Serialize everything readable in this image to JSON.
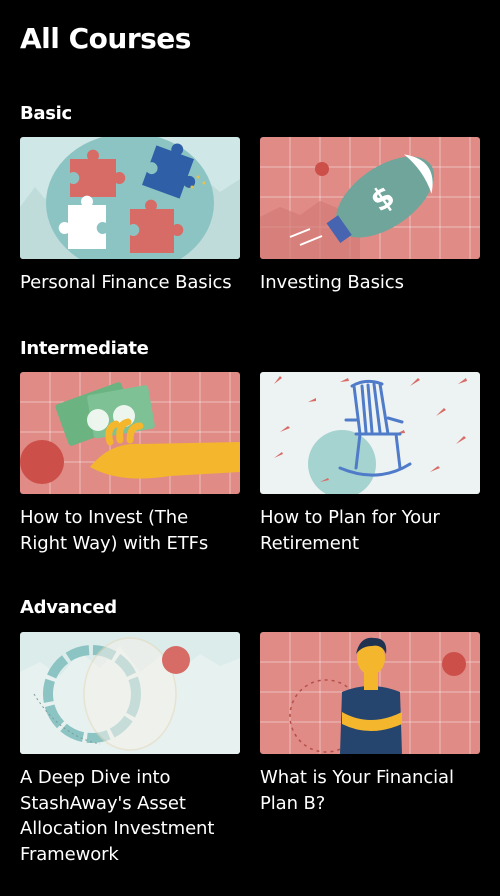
{
  "page": {
    "title": "All Courses"
  },
  "sections": [
    {
      "heading": "Basic",
      "courses": [
        {
          "title": "Personal Finance Basics",
          "thumb_bg": "#cfe7e6"
        },
        {
          "title": "Investing Basics",
          "thumb_bg": "#e08b86"
        }
      ]
    },
    {
      "heading": "Intermediate",
      "courses": [
        {
          "title": "How to Invest (The Right Way) with ETFs",
          "thumb_bg": "#e08b86"
        },
        {
          "title": "How to Plan for Your Retirement",
          "thumb_bg": "#edf3f3"
        }
      ]
    },
    {
      "heading": "Advanced",
      "courses": [
        {
          "title": "A Deep Dive into StashAway's Asset Allocation Investment Framework",
          "thumb_bg": "#dbecea"
        },
        {
          "title": "What is Your Financial Plan B?",
          "thumb_bg": "#e08b86"
        }
      ]
    }
  ],
  "icons": {
    "puzzle": "puzzle-pieces-illustration",
    "rocket": "dollar-rocket-illustration",
    "money": "money-hand-illustration",
    "chair": "rocking-chair-illustration",
    "rings": "allocation-rings-illustration",
    "person": "person-crossed-arms-illustration"
  }
}
